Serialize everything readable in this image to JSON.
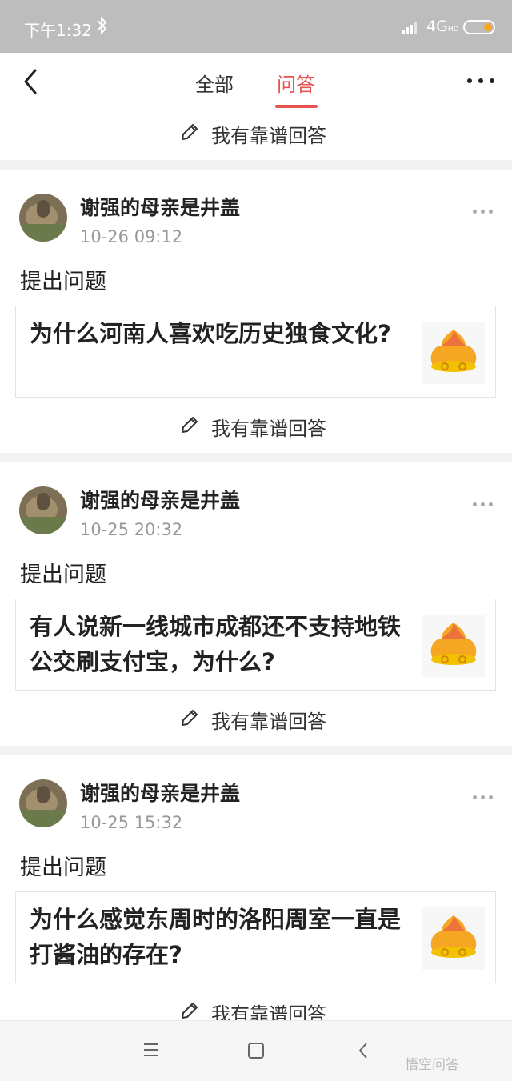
{
  "status_bar": {
    "time": "下午1:32",
    "network": "4G",
    "network_sub": "HD"
  },
  "nav": {
    "tab_all": "全部",
    "tab_qa": "问答",
    "active_color": "#e8524f"
  },
  "answer_label": "我有靠谱回答",
  "posts": [
    {
      "user": "谢强的母亲是井盖",
      "time": "10-26 09:12",
      "action": "提出问题",
      "question": "为什么河南人喜欢吃历史独食文化?"
    },
    {
      "user": "谢强的母亲是井盖",
      "time": "10-25 20:32",
      "action": "提出问题",
      "question": "有人说新一线城市成都还不支持地铁公交刷支付宝，为什么?"
    },
    {
      "user": "谢强的母亲是井盖",
      "time": "10-25 15:32",
      "action": "提出问题",
      "question": "为什么感觉东周时的洛阳周室一直是打酱油的存在?"
    }
  ],
  "watermark": "悟空问答",
  "icons": [
    "bluetooth-icon",
    "signal-icon",
    "battery-icon",
    "back-icon",
    "more-icon",
    "pencil-icon",
    "menu-icon",
    "home-icon",
    "back-nav-icon"
  ]
}
